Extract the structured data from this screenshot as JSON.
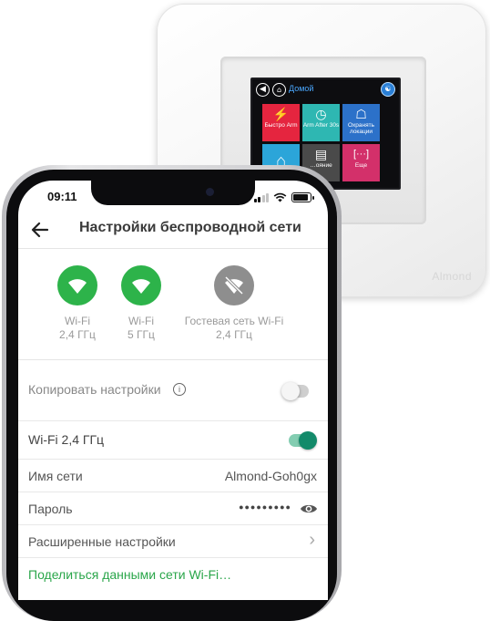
{
  "device": {
    "screen_title": "Домой",
    "brand": "Almond",
    "page_indicator": {
      "pages": 4,
      "active": 1
    },
    "tiles": [
      {
        "label": "Быстро Arm",
        "icon": "shield-icon",
        "color": "#e5253f"
      },
      {
        "label": "Arm After 30s",
        "icon": "shield-timer-icon",
        "color": "#2eb7b2"
      },
      {
        "label": "Охранять локации",
        "icon": "shield-home-icon",
        "color": "#2c71c9"
      },
      {
        "label": "",
        "icon": "home-wifi-icon",
        "color": "#2ba5d9"
      },
      {
        "label": "…ояние",
        "icon": "devices-icon",
        "color": "#4a4a4a"
      },
      {
        "label": "Еще",
        "icon": "more-icon",
        "color": "#d3306a"
      }
    ]
  },
  "phone": {
    "status_bar": {
      "time": "09:11"
    },
    "app_bar": {
      "title": "Настройки беспроводной сети"
    },
    "networks": [
      {
        "line1": "Wi-Fi",
        "line2": "2,4 ГГц",
        "active": true,
        "color": "#2db34a"
      },
      {
        "line1": "Wi-Fi",
        "line2": "5 ГГц",
        "active": true,
        "color": "#2db34a"
      },
      {
        "line1": "Гостевая сеть Wi-Fi",
        "line2": "2,4 ГГц",
        "active": false,
        "color": "#8e8e8e"
      }
    ],
    "copy_settings": {
      "label": "Копировать настройки",
      "info_icon": "i",
      "enabled": false
    },
    "wifi_24": {
      "label": "Wi-Fi 2,4 ГГц",
      "enabled": true
    },
    "ssid": {
      "label": "Имя сети",
      "value": "Almond-Goh0gx"
    },
    "password": {
      "label": "Пароль",
      "value": "●●●●●●●●●"
    },
    "advanced": {
      "label": "Расширенные настройки",
      "chevron": "›"
    },
    "share": {
      "label": "Поделиться данными сети Wi-Fi…"
    },
    "accent_color": "#2db34a"
  }
}
